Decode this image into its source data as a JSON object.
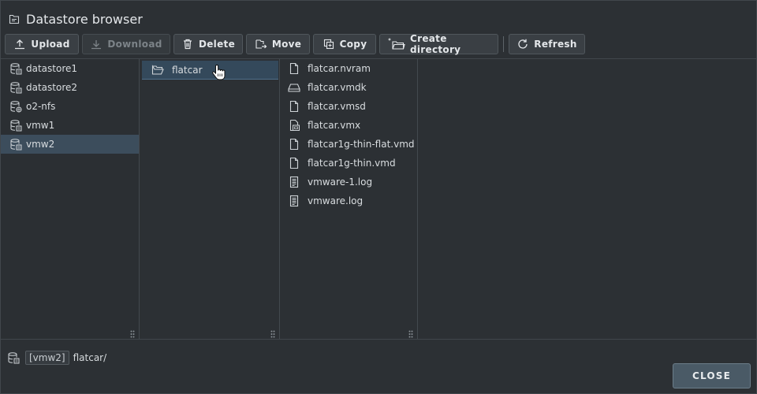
{
  "dialog": {
    "title": "Datastore browser"
  },
  "toolbar": {
    "upload": "Upload",
    "download": "Download",
    "delete": "Delete",
    "move": "Move",
    "copy": "Copy",
    "create_directory": "Create directory",
    "refresh": "Refresh"
  },
  "datastores": [
    {
      "label": "datastore1",
      "icon": "datastore-icon"
    },
    {
      "label": "datastore2",
      "icon": "datastore-icon"
    },
    {
      "label": "o2-nfs",
      "icon": "nfs-datastore-icon"
    },
    {
      "label": "vmw1",
      "icon": "datastore-icon"
    },
    {
      "label": "vmw2",
      "icon": "datastore-icon",
      "selected": true
    }
  ],
  "folders": [
    {
      "label": "flatcar",
      "icon": "folder-open-icon",
      "selected": true
    }
  ],
  "files": [
    {
      "label": "flatcar.nvram",
      "icon": "file-icon"
    },
    {
      "label": "flatcar.vmdk",
      "icon": "disk-icon"
    },
    {
      "label": "flatcar.vmsd",
      "icon": "file-icon"
    },
    {
      "label": "flatcar.vmx",
      "icon": "vm-config-icon"
    },
    {
      "label": "flatcar1g-thin-flat.vmd",
      "icon": "file-icon"
    },
    {
      "label": "flatcar1g-thin.vmd",
      "icon": "file-icon"
    },
    {
      "label": "vmware-1.log",
      "icon": "log-file-icon"
    },
    {
      "label": "vmware.log",
      "icon": "log-file-icon"
    }
  ],
  "pathbar": {
    "datastore": "[vmw2]",
    "path": "flatcar/"
  },
  "footer": {
    "close": "CLOSE"
  },
  "colors": {
    "selection": "#3c4d5c",
    "background": "#2c3034",
    "button": "#3a3f44",
    "close_button": "#4a5a66"
  }
}
